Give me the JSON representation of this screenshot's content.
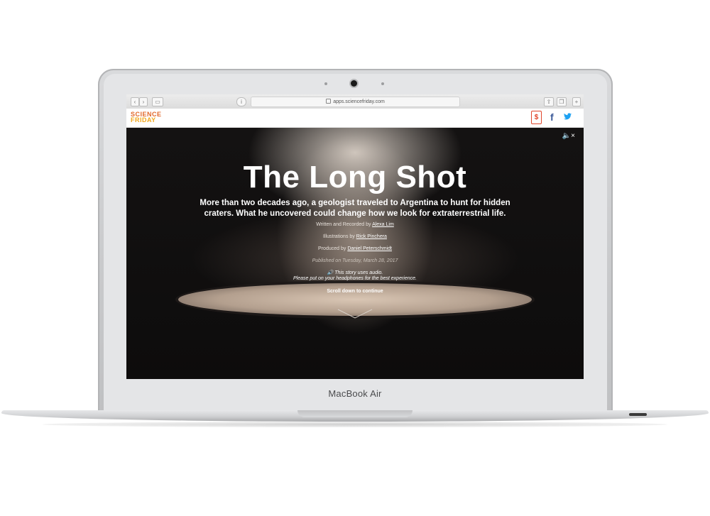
{
  "device": {
    "brand_label": "MacBook Air"
  },
  "browser": {
    "url": "apps.sciencefriday.com"
  },
  "site": {
    "logo_line1": "SCIENCE",
    "logo_line2": "FRIDAY",
    "donate_icon": "$",
    "facebook_icon": "f",
    "twitter_icon": "t"
  },
  "story": {
    "title": "The Long Shot",
    "subtitle": "More than two decades ago, a geologist traveled to Argentina to hunt for hidden craters. What he uncovered could change how we look for extraterrestrial life.",
    "written_prefix": "Written and Recorded by",
    "written_name": "Alexa Lim",
    "illustrations_prefix": "Illustrations by",
    "illustrations_name": "Rick Pinchera",
    "produced_prefix": "Produced by",
    "produced_name": "Daniel Peterschmidt",
    "published": "Published on Tuesday, March 28, 2017",
    "audio_note": "This story uses audio.",
    "headphones_note": "Please put on your headphones for the best experience.",
    "scroll_cta": "Scroll down to continue"
  },
  "colors": {
    "logo_orange": "#e2682a",
    "logo_yellow": "#f2a71b",
    "donate_red": "#e0462b",
    "facebook": "#3b5998",
    "twitter": "#1da1f2"
  }
}
